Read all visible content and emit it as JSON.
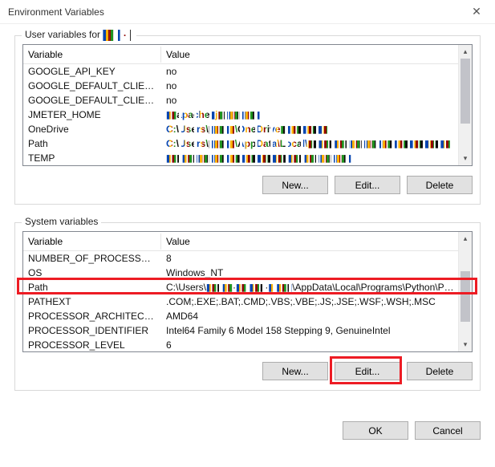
{
  "window": {
    "title": "Environment Variables",
    "close_glyph": "✕"
  },
  "user_section": {
    "legend_prefix": "User variables for ",
    "legend_user_obf": "█▌▌·▐",
    "columns": {
      "variable": "Variable",
      "value": "Value"
    },
    "rows": [
      {
        "variable": "GOOGLE_API_KEY",
        "value": "no"
      },
      {
        "variable": "GOOGLE_DEFAULT_CLIENT_ID",
        "value": "no"
      },
      {
        "variable": "GOOGLE_DEFAULT_CLIENT_...",
        "value": "no"
      },
      {
        "variable": "JMETER_HOME",
        "value": "▮▮apache▮j▮▮▮▮▮▮▮▮"
      },
      {
        "variable": "OneDrive",
        "value": "C:\\Users\\▮▮▮▮▮\\OneDrive▮▮▮▮▮▮▮▮▮"
      },
      {
        "variable": "Path",
        "value": "C:\\Users\\▮▮▮▮▮\\AppData\\Local\\▮▮▮▮▮▮▮▮▮▮▮▮▮▮▮▮▮▮▮▮▮▮▮▮▮▮▮"
      },
      {
        "variable": "TEMP",
        "value": "▮▮▮▮▮▮▮▮▮▮▮▮▮▮▮▮▮▮▮▮▮▮▮▮▮▮▮▮▮▮▮▮▮▮▮"
      }
    ],
    "buttons": {
      "new": "New...",
      "edit": "Edit...",
      "delete": "Delete"
    }
  },
  "system_section": {
    "legend": "System variables",
    "columns": {
      "variable": "Variable",
      "value": "Value"
    },
    "rows": [
      {
        "variable": "NUMBER_OF_PROCESSORS",
        "value": "8"
      },
      {
        "variable": "OS",
        "value": "Windows_NT"
      },
      {
        "variable": "Path",
        "value": "C:\\Users\\▮▮▮▮▮·▮▮ ▮▮▮·▮ ▮▮▮\\AppData\\Local\\Programs\\Python\\Pyth..."
      },
      {
        "variable": "PATHEXT",
        "value": ".COM;.EXE;.BAT;.CMD;.VBS;.VBE;.JS;.JSE;.WSF;.WSH;.MSC"
      },
      {
        "variable": "PROCESSOR_ARCHITECTURE",
        "value": "AMD64"
      },
      {
        "variable": "PROCESSOR_IDENTIFIER",
        "value": "Intel64 Family 6 Model 158 Stepping 9, GenuineIntel"
      },
      {
        "variable": "PROCESSOR_LEVEL",
        "value": "6"
      }
    ],
    "highlighted_row_index": 2,
    "buttons": {
      "new": "New...",
      "edit": "Edit...",
      "delete": "Delete"
    }
  },
  "footer": {
    "ok": "OK",
    "cancel": "Cancel"
  },
  "scroll": {
    "up_glyph": "▴",
    "down_glyph": "▾"
  }
}
